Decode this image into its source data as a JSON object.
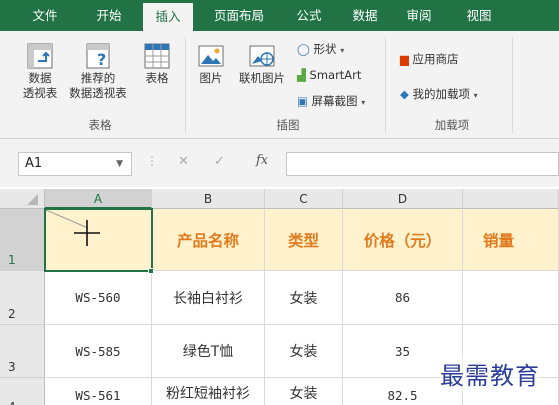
{
  "tabs": [
    {
      "label": "文件",
      "active": false
    },
    {
      "label": "开始",
      "active": false
    },
    {
      "label": "插入",
      "active": true
    },
    {
      "label": "页面布局",
      "active": false
    },
    {
      "label": "公式",
      "active": false
    },
    {
      "label": "数据",
      "active": false
    },
    {
      "label": "审阅",
      "active": false
    },
    {
      "label": "视图",
      "active": false
    }
  ],
  "ribbon": {
    "pivot_table": "数据\n透视表",
    "recommended_pivot": "推荐的\n数据透视表",
    "table": "表格",
    "group_tables": "表格",
    "pictures": "图片",
    "online_pictures": "联机图片",
    "shapes": "形状",
    "smartart": "SmartArt",
    "screenshot": "屏幕截图",
    "group_illustrations": "插图",
    "store": "应用商店",
    "my_addins": "我的加载项",
    "group_addins": "加载项"
  },
  "formula_bar": {
    "name_box": "A1",
    "fx": "fx",
    "value": ""
  },
  "columns": [
    "A",
    "B",
    "C",
    "D",
    ""
  ],
  "rows": [
    {
      "num": "1",
      "cells": [
        "",
        "产品名称",
        "类型",
        "价格（元）",
        "销量"
      ]
    },
    {
      "num": "2",
      "cells": [
        "WS-560",
        "长袖白衬衫",
        "女装",
        "86",
        ""
      ]
    },
    {
      "num": "3",
      "cells": [
        "WS-585",
        "绿色T恤",
        "女装",
        "35",
        ""
      ]
    },
    {
      "num": "4",
      "cells": [
        "WS-561",
        "粉红短袖衬衫",
        "女装",
        "82.5",
        ""
      ]
    }
  ],
  "watermark": "最需教育",
  "colors": {
    "brand": "#217346",
    "header_fill": "#fff2cc",
    "header_text": "#e07b1e"
  }
}
